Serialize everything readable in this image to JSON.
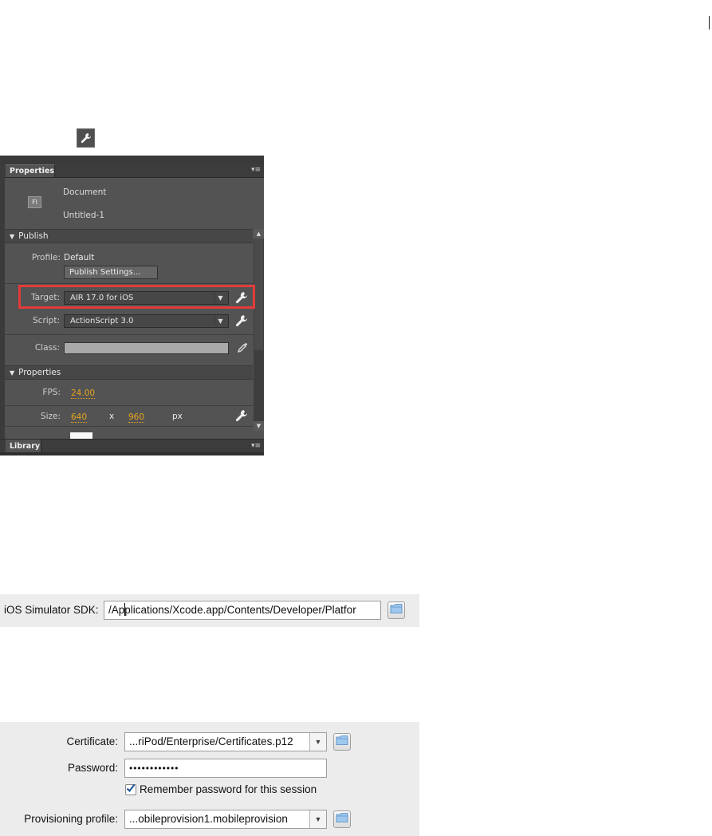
{
  "panel": {
    "tab_properties": "Properties",
    "tab_menu_glyph": "▾≡",
    "doc_icon_text": "Fl",
    "doc_type": "Document",
    "doc_name": "Untitled-1",
    "publish_section": "Publish",
    "profile_label": "Profile:",
    "profile_value": "Default",
    "publish_settings_button": "Publish Settings...",
    "target_label": "Target:",
    "target_value": "AIR 17.0 for iOS",
    "script_label": "Script:",
    "script_value": "ActionScript 3.0",
    "class_label": "Class:",
    "properties_section": "Properties",
    "fps_label": "FPS:",
    "fps_value": "24.00",
    "size_label": "Size:",
    "size_width": "640",
    "size_x": "x",
    "size_height": "960",
    "size_unit": "px",
    "tab_library": "Library",
    "colors": {
      "panel_bg": "#535353",
      "highlight_box": "#e23b3b",
      "hot_text": "#e6a31c"
    }
  },
  "sdk": {
    "label": "iOS Simulator SDK:",
    "path_before_caret": "/Ap",
    "path_after_caret": "plications/Xcode.app/Contents/Developer/Platfor"
  },
  "signing": {
    "certificate_label": "Certificate:",
    "certificate_value": "...riPod/Enterprise/Certificates.p12",
    "password_label": "Password:",
    "password_value": "••••••••••••",
    "remember_label": "Remember password for this session",
    "remember_checked": true,
    "provisioning_label": "Provisioning profile:",
    "provisioning_value": "...obileprovision1.mobileprovision"
  },
  "icons": [
    "wrench-icon",
    "folder-icon",
    "eyedropper-icon",
    "dropdown-arrow-icon",
    "checkmark-icon"
  ]
}
